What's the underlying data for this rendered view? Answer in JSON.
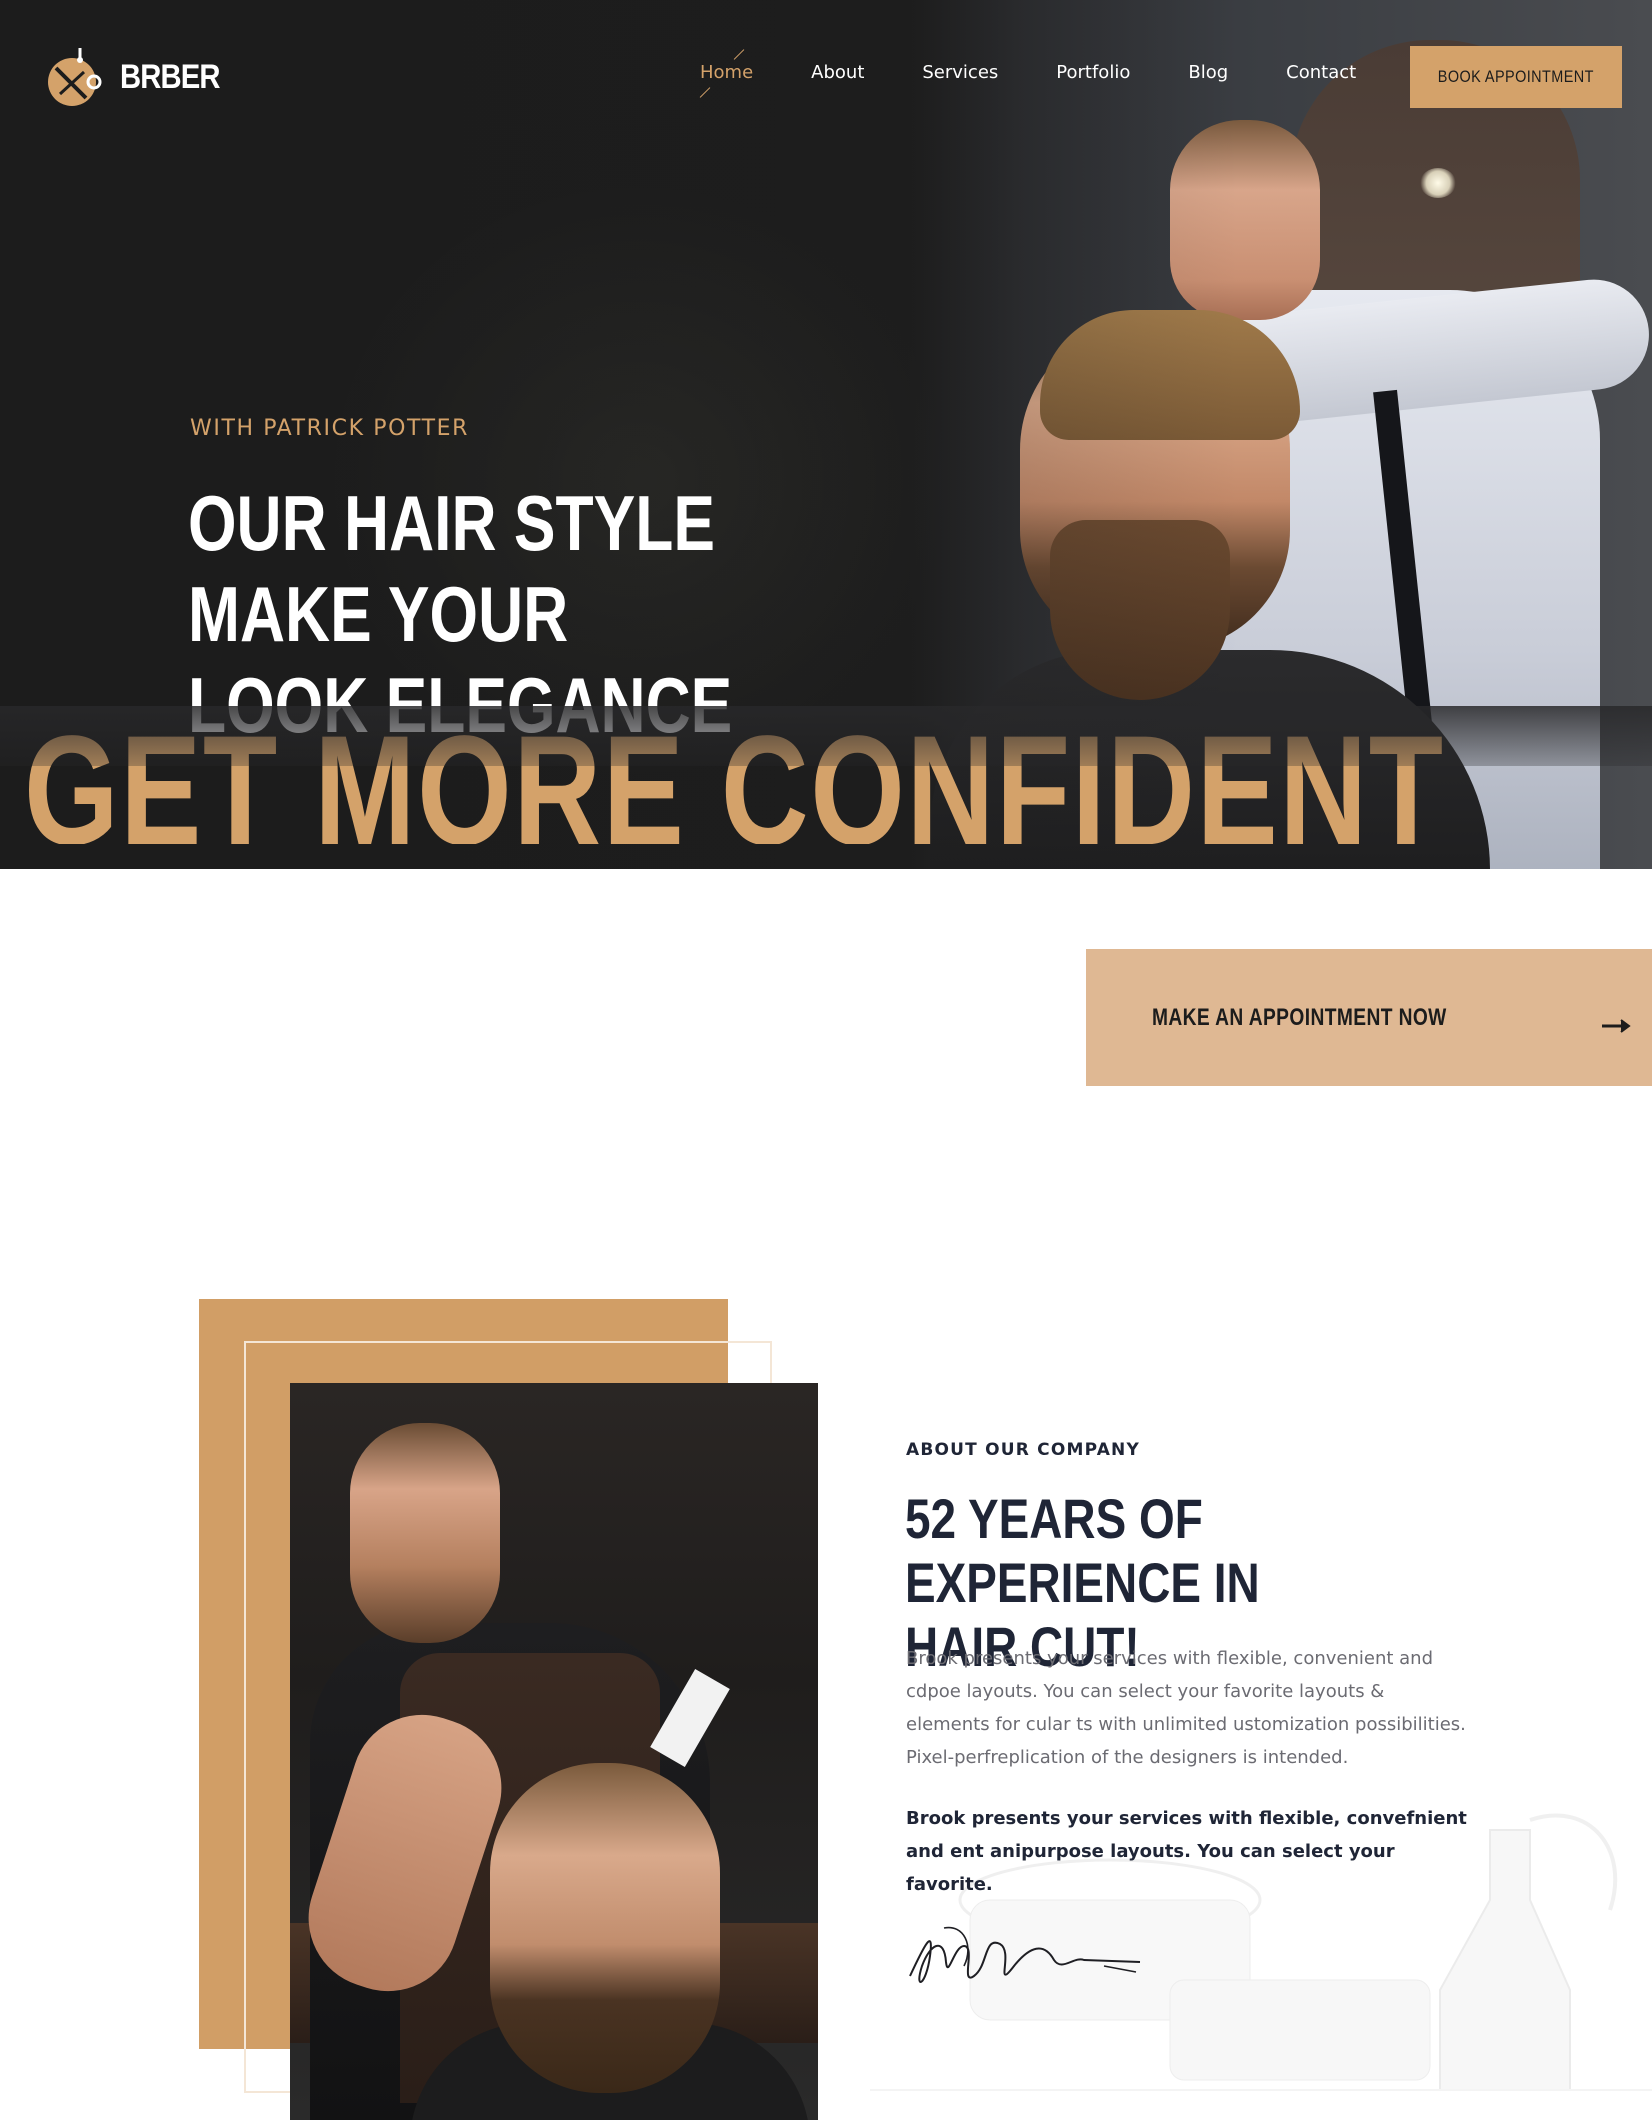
{
  "header": {
    "logo_text": "BRBER",
    "nav": [
      {
        "label": "Home",
        "active": true
      },
      {
        "label": "About"
      },
      {
        "label": "Services"
      },
      {
        "label": "Portfolio"
      },
      {
        "label": "Blog"
      },
      {
        "label": "Contact"
      }
    ],
    "book_label": "BOOK APPOINTMENT"
  },
  "hero": {
    "subtitle": "WITH PATRICK POTTER",
    "title_line1": "OUR HAIR STYLE MAKE YOUR",
    "title_line2": "LOOK ELEGANCE",
    "big_text": "GET MORE CONFIDENT"
  },
  "appointment": {
    "label": "MAKE AN APPOINTMENT NOW",
    "arrow_icon": "arrow-right-icon"
  },
  "about": {
    "kicker": "ABOUT OUR COMPANY",
    "title_line1": "52 YEARS OF EXPERIENCE IN",
    "title_line2": "HAIR CUT!",
    "paragraph1": "Brook presents your services with flexible, convenient and cdpoe layouts. You can select your favorite layouts & elements for cular ts with unlimited ustomization possibilities. Pixel-perfreplication of the designers is intended.",
    "paragraph2": "Brook presents your services with flexible, convefnient and ent anipurpose layouts. You can select your favorite."
  },
  "colors": {
    "accent": "#d4a26a",
    "accent_light": "#dfb893",
    "dark": "#1c1c1c",
    "heading": "#1f2536"
  }
}
